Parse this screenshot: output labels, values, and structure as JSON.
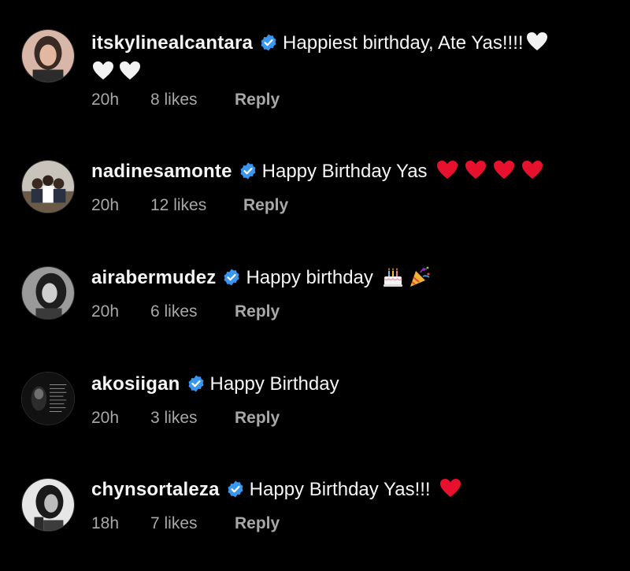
{
  "colors": {
    "background": "#000000",
    "text": "#f5f5f5",
    "muted": "#a8a8a8",
    "verified": "#3897f0",
    "heart_red": "#e8112d",
    "heart_white": "#f2f2f2"
  },
  "comments": [
    {
      "username": "itskylinealcantara",
      "verified": true,
      "text": "Happiest birthday, Ate Yas!!!!",
      "emojis": [
        "white-heart",
        "white-heart",
        "white-heart"
      ],
      "time": "20h",
      "likes": "8 likes",
      "reply": "Reply"
    },
    {
      "username": "nadinesamonte",
      "verified": true,
      "text": "Happy Birthday Yas",
      "emojis": [
        "red-heart",
        "red-heart",
        "red-heart",
        "red-heart"
      ],
      "time": "20h",
      "likes": "12 likes",
      "reply": "Reply"
    },
    {
      "username": "airabermudez",
      "verified": true,
      "text": "Happy birthday",
      "emojis": [
        "birthday-cake",
        "party-popper"
      ],
      "time": "20h",
      "likes": "6 likes",
      "reply": "Reply"
    },
    {
      "username": "akosiigan",
      "verified": true,
      "text": "Happy Birthday",
      "emojis": [],
      "time": "20h",
      "likes": "3 likes",
      "reply": "Reply"
    },
    {
      "username": "chynsortaleza",
      "verified": true,
      "text": "Happy Birthday Yas!!!",
      "emojis": [
        "red-heart"
      ],
      "time": "18h",
      "likes": "7 likes",
      "reply": "Reply"
    }
  ]
}
